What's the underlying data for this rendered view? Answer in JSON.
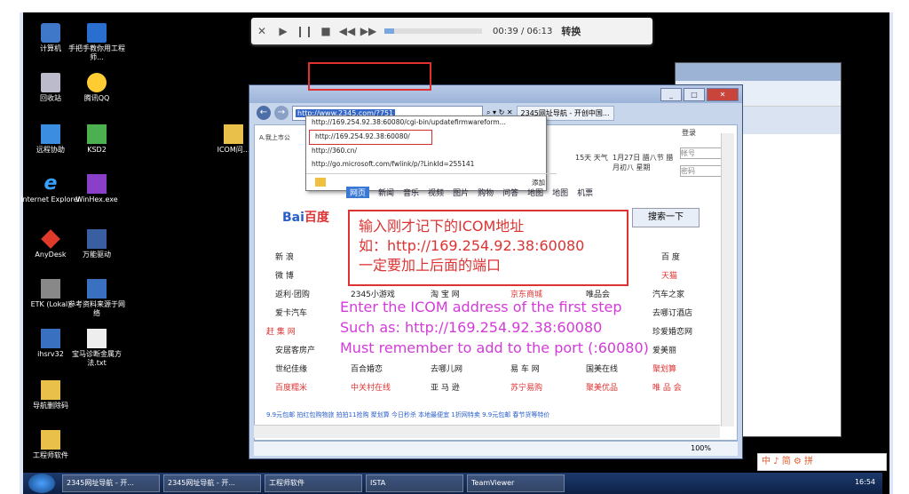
{
  "player": {
    "time": "00:39 / 06:13",
    "convert": "转换",
    "progress": 0.1
  },
  "desktop_icons": [
    {
      "name": "computer-icon",
      "label": "计算机"
    },
    {
      "name": "folder-icon",
      "label": "手把手教你用工程师..."
    },
    {
      "name": "recycle-bin-icon",
      "label": "回收站"
    },
    {
      "name": "qq-icon",
      "label": "腾讯QQ"
    },
    {
      "name": "remote-help-icon",
      "label": "远程协助"
    },
    {
      "name": "ksd2-icon",
      "label": "KSD2"
    },
    {
      "name": "ie-icon",
      "label": "Internet Explorer"
    },
    {
      "name": "winhex-icon",
      "label": "WinHex.exe"
    },
    {
      "name": "anydesk-icon",
      "label": "AnyDesk"
    },
    {
      "name": "drive-icon",
      "label": "万能驱动"
    },
    {
      "name": "etk-icon",
      "label": "ETK (Lokal)"
    },
    {
      "name": "reference-icon",
      "label": "参考资料来源于网络"
    },
    {
      "name": "ihsrv-icon",
      "label": "ihsrv32"
    },
    {
      "name": "txt-icon",
      "label": "宝马诊断金属方法.txt"
    },
    {
      "name": "folder-icon",
      "label": "导航删除码"
    },
    {
      "name": "icom-folder-icon",
      "label": "ICOM问..."
    },
    {
      "name": "engineer-folder-icon",
      "label": "工程师软件"
    }
  ],
  "ie": {
    "url": "http://www.2345.com/?751",
    "tab": "2345网址导航 - 开创中国...",
    "dropdown": [
      "http://169.254.92.38:60080/cgi-bin/updatefirmwareform...",
      "http://169.254.92.38:60080/",
      "http://360.cn/",
      "http://go.microsoft.com/fwlink/p/?LinkId=255141"
    ],
    "dropdown_add": "添加",
    "navlinks": [
      "网页",
      "新闻",
      "音乐",
      "视频",
      "图片",
      "购物",
      "问答",
      "地图",
      "地图",
      "机票"
    ],
    "baidu_logo": "Bai",
    "baidu_logo2": "百度",
    "search_btn": "搜索一下",
    "login_hint": "A.我上市公",
    "weather": "15天 天气",
    "date": "1月27日 腊八节 腊月初八 星期",
    "login": "登录",
    "fields": [
      "帐号",
      "密码"
    ],
    "grid": [
      [
        "新 浪",
        "",
        "",
        "",
        "",
        "百 度"
      ],
      [
        "微 博",
        "",
        "",
        "",
        "",
        "天猫"
      ],
      [
        "返利·团购",
        "2345小游戏",
        "淘 宝 网",
        "京东商城",
        "唯品会",
        "汽车之家"
      ],
      [
        "爱卡汽车",
        "",
        "",
        "",
        "",
        "去哪订酒店"
      ],
      [
        "赶 集 网",
        "",
        "",
        "",
        "",
        "珍爱婚恋网"
      ],
      [
        "安居客房产",
        "",
        "",
        "",
        "",
        "爱美丽"
      ],
      [
        "世纪佳缘",
        "百合婚恋",
        "去哪儿网",
        "易 车 网",
        "国美在线",
        "聚划算"
      ],
      [
        "百度糯米",
        "中关村在线",
        "亚 马 逊",
        "苏宁易购",
        "聚美优品",
        "唯 品 会"
      ]
    ],
    "bottom_links": "9.9元包邮   拍红包购物旅  拍拍11抢购  聚划算  今日秒杀  本地最便宜  1折网特卖  9.9元包邮  春节货等特价",
    "zoom": "100%"
  },
  "annotation_cn": [
    "输入刚才记下的ICOM地址",
    "如：http://169.254.92.38:60080",
    "一定要加上后面的端口"
  ],
  "annotation_en": [
    "Enter the ICOM address of the first step",
    "Such as: http://169.254.92.38:60080",
    "Must remember  to add to the port (:60080)"
  ],
  "taskbar": {
    "tasks": [
      "2345网址导航 - 开...",
      "2345网址导航 - 开...",
      "工程师软件",
      "ISTA",
      "TeamViewer"
    ],
    "time": "16:54"
  },
  "sogou": "中 ♪ 简 ⚙ 拼"
}
